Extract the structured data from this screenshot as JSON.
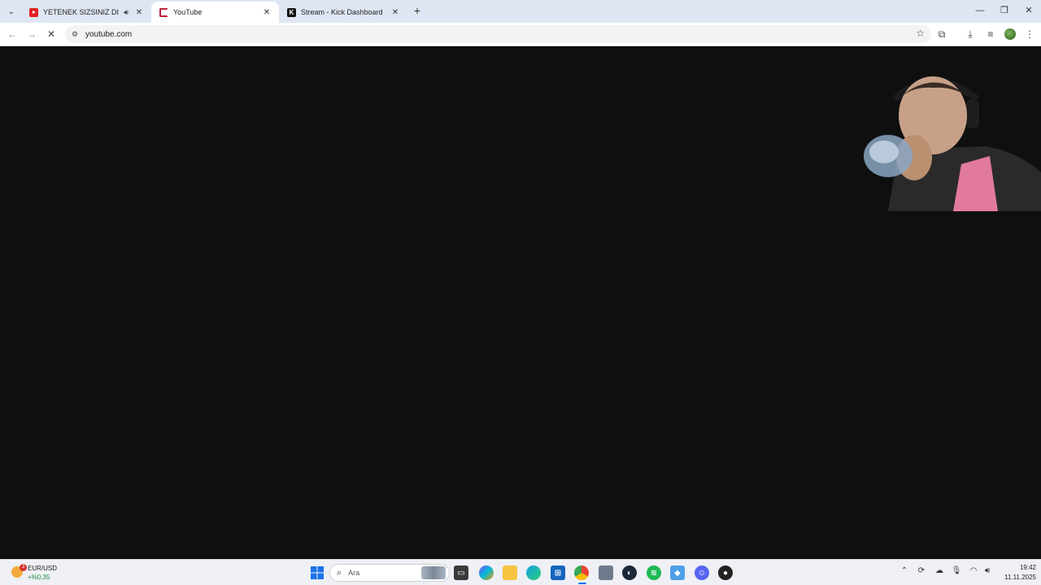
{
  "browser": {
    "tabs": [
      {
        "title": "YETENEK SIZSINIZ DISCORD",
        "favicon": "youtube-icon",
        "audio": true,
        "active": false
      },
      {
        "title": "YouTube",
        "favicon": "loading-icon",
        "audio": false,
        "active": true
      },
      {
        "title": "Stream - Kick Dashboard",
        "favicon": "kick-icon",
        "audio": false,
        "active": false
      }
    ],
    "kick_letter": "K",
    "url": "youtube.com"
  },
  "taskbar": {
    "widget": {
      "badge": "3",
      "label": "EUR/USD",
      "value": "+%0,35"
    },
    "search_placeholder": "Ara",
    "clock": {
      "time": "19:42",
      "date": "11.11.2025"
    }
  },
  "colors": {
    "tabstrip": "#dfe6f3",
    "content_bg": "#0f0f0f",
    "taskbar": "#eef0f5",
    "accent": "#1a73e8"
  }
}
